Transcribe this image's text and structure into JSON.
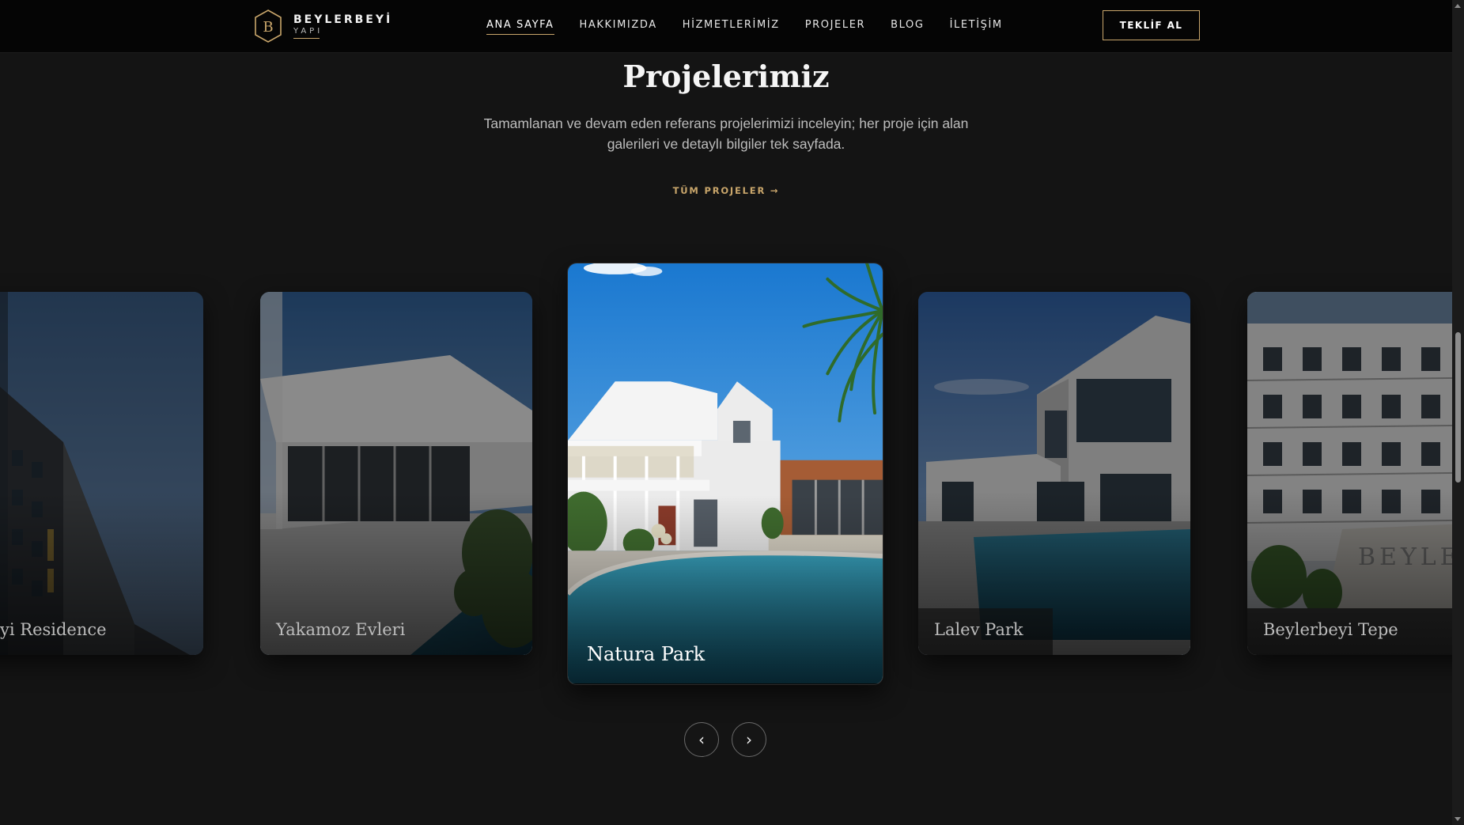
{
  "header": {
    "logo_name": "BEYLERBEYİ",
    "logo_sub": "YAPI",
    "nav": [
      {
        "label": "ANA SAYFA",
        "active": true
      },
      {
        "label": "HAKKIMIZDA",
        "active": false
      },
      {
        "label": "HİZMETLERİMİZ",
        "active": false
      },
      {
        "label": "PROJELER",
        "active": false
      },
      {
        "label": "BLOG",
        "active": false
      },
      {
        "label": "İLETİŞİM",
        "active": false
      }
    ],
    "cta_label": "TEKLİF AL"
  },
  "section": {
    "title": "Projelerimiz",
    "subtitle": "Tamamlanan ve devam eden referans projelerimizi inceleyin; her proje için alan galerileri ve detaylı bilgiler tek sayfada.",
    "all_link": "TÜM PROJELER →"
  },
  "projects": [
    {
      "name": "Beylerbeyi Residence",
      "visible_label": "yi Residence",
      "state": "side"
    },
    {
      "name": "Yakamoz Evleri",
      "visible_label": "Yakamoz Evleri",
      "state": "side"
    },
    {
      "name": "Natura Park",
      "visible_label": "Natura Park",
      "state": "active"
    },
    {
      "name": "Lalev Park",
      "visible_label": "Lalev Park",
      "state": "side"
    },
    {
      "name": "Beylerbeyi Tepe",
      "visible_label": "Beylerbeyi Tepe",
      "state": "side"
    }
  ],
  "carousel": {
    "prev_icon": "chevron-left-icon",
    "next_icon": "chevron-right-icon",
    "prev_glyph": "‹",
    "next_glyph": "›"
  },
  "colors": {
    "accent": "#c9a66b",
    "background": "#141414",
    "header": "#050505"
  }
}
